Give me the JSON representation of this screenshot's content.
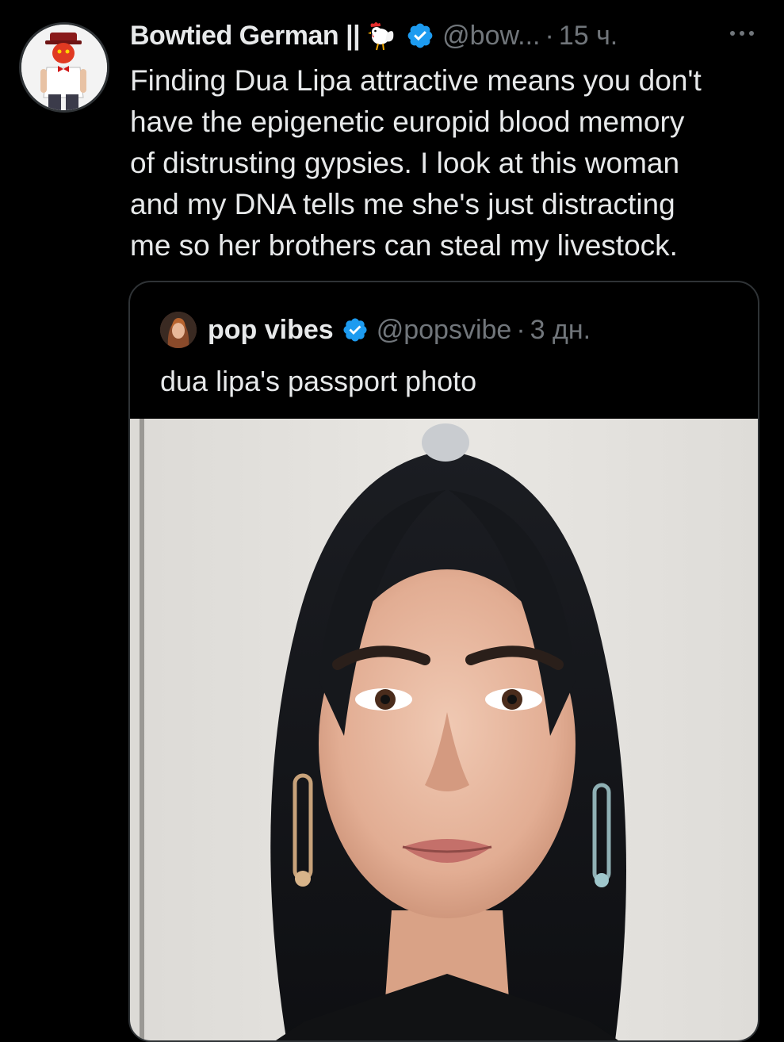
{
  "tweet": {
    "display_name": "Bowtied German ||",
    "handle": "@bow...",
    "separator": "·",
    "time": "15 ч.",
    "text": "Finding Dua Lipa attractive means you don't\nhave the epigenetic europid blood memory\nof distrusting gypsies.  I look at this woman\nand my DNA tells me she's just distracting\nme so her brothers can steal my livestock.",
    "badge_icon": "chicken-icon",
    "verified_icon": "verified-badge-icon",
    "more_icon": "more-options-icon"
  },
  "quote": {
    "display_name": "pop vibes",
    "handle": "@popsvibe",
    "separator": "·",
    "time": "3 дн.",
    "text": "dua lipa's passport photo"
  },
  "colors": {
    "background": "#000000",
    "text_primary": "#e7e9ea",
    "text_secondary": "#71767b",
    "verified_blue": "#1d9bf0",
    "border": "#2f3336"
  }
}
